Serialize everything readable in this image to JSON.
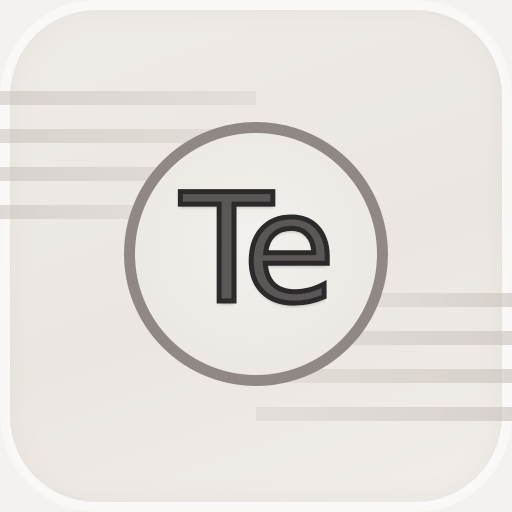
{
  "app_icon": {
    "logo_text": "Te",
    "colors": {
      "background": "#ebe6e1",
      "ring": "#908885",
      "stripes": "#c8c0ba",
      "text_fill": "#5a5756",
      "text_outline": "#2b2a2a"
    }
  }
}
